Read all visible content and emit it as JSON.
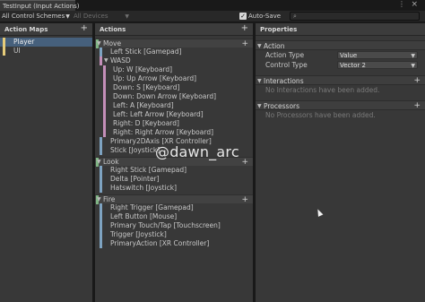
{
  "window": {
    "tab_title": "TestInput (Input Actions)",
    "menu_icon": "kebab-menu",
    "close_icon": "close"
  },
  "toolbar": {
    "control_schemes": "All Control Schemes",
    "devices": "All Devices",
    "auto_save_checked": true,
    "auto_save_label": "Auto-Save",
    "search_value": ""
  },
  "action_maps": {
    "header": "Action Maps",
    "items": [
      {
        "label": "Player",
        "selected": true
      },
      {
        "label": "UI",
        "selected": false
      }
    ]
  },
  "actions": {
    "header": "Actions",
    "rows": [
      {
        "kind": "action",
        "label": "Move",
        "expanded": true
      },
      {
        "kind": "binding",
        "label": "Left Stick [Gamepad]"
      },
      {
        "kind": "composite",
        "label": "WASD",
        "expanded": true
      },
      {
        "kind": "part",
        "label": "Up: W [Keyboard]"
      },
      {
        "kind": "part",
        "label": "Up: Up Arrow [Keyboard]"
      },
      {
        "kind": "part",
        "label": "Down: S [Keyboard]"
      },
      {
        "kind": "part",
        "label": "Down: Down Arrow [Keyboard]"
      },
      {
        "kind": "part",
        "label": "Left: A [Keyboard]"
      },
      {
        "kind": "part",
        "label": "Left: Left Arrow [Keyboard]"
      },
      {
        "kind": "part",
        "label": "Right: D [Keyboard]"
      },
      {
        "kind": "part",
        "label": "Right: Right Arrow [Keyboard]"
      },
      {
        "kind": "binding",
        "label": "Primary2DAxis [XR Controller]"
      },
      {
        "kind": "binding",
        "label": "Stick [Joystick]"
      },
      {
        "kind": "action",
        "label": "Look",
        "expanded": true
      },
      {
        "kind": "binding",
        "label": "Right Stick [Gamepad]"
      },
      {
        "kind": "binding",
        "label": "Delta [Pointer]"
      },
      {
        "kind": "binding",
        "label": "Hatswitch [Joystick]"
      },
      {
        "kind": "action",
        "label": "Fire",
        "expanded": true
      },
      {
        "kind": "binding",
        "label": "Right Trigger [Gamepad]"
      },
      {
        "kind": "binding",
        "label": "Left Button [Mouse]"
      },
      {
        "kind": "binding",
        "label": "Primary Touch/Tap [Touchscreen]"
      },
      {
        "kind": "binding",
        "label": "Trigger [Joystick]"
      },
      {
        "kind": "binding",
        "label": "PrimaryAction [XR Controller]"
      }
    ]
  },
  "properties": {
    "header": "Properties",
    "action_section": {
      "title": "Action",
      "fields": [
        {
          "label": "Action Type",
          "value": "Value"
        },
        {
          "label": "Control Type",
          "value": "Vector 2"
        }
      ]
    },
    "interactions": {
      "title": "Interactions",
      "empty_text": "No Interactions have been added."
    },
    "processors": {
      "title": "Processors",
      "empty_text": "No Processors have been added."
    }
  },
  "watermark": "@dawn_arc",
  "colors": {
    "selection": "#46607c",
    "action_bar": "#7fb484",
    "composite_bar": "#c48fb9",
    "binding_bar": "#7ea3c1",
    "map_bar": "#e6cc7a"
  }
}
